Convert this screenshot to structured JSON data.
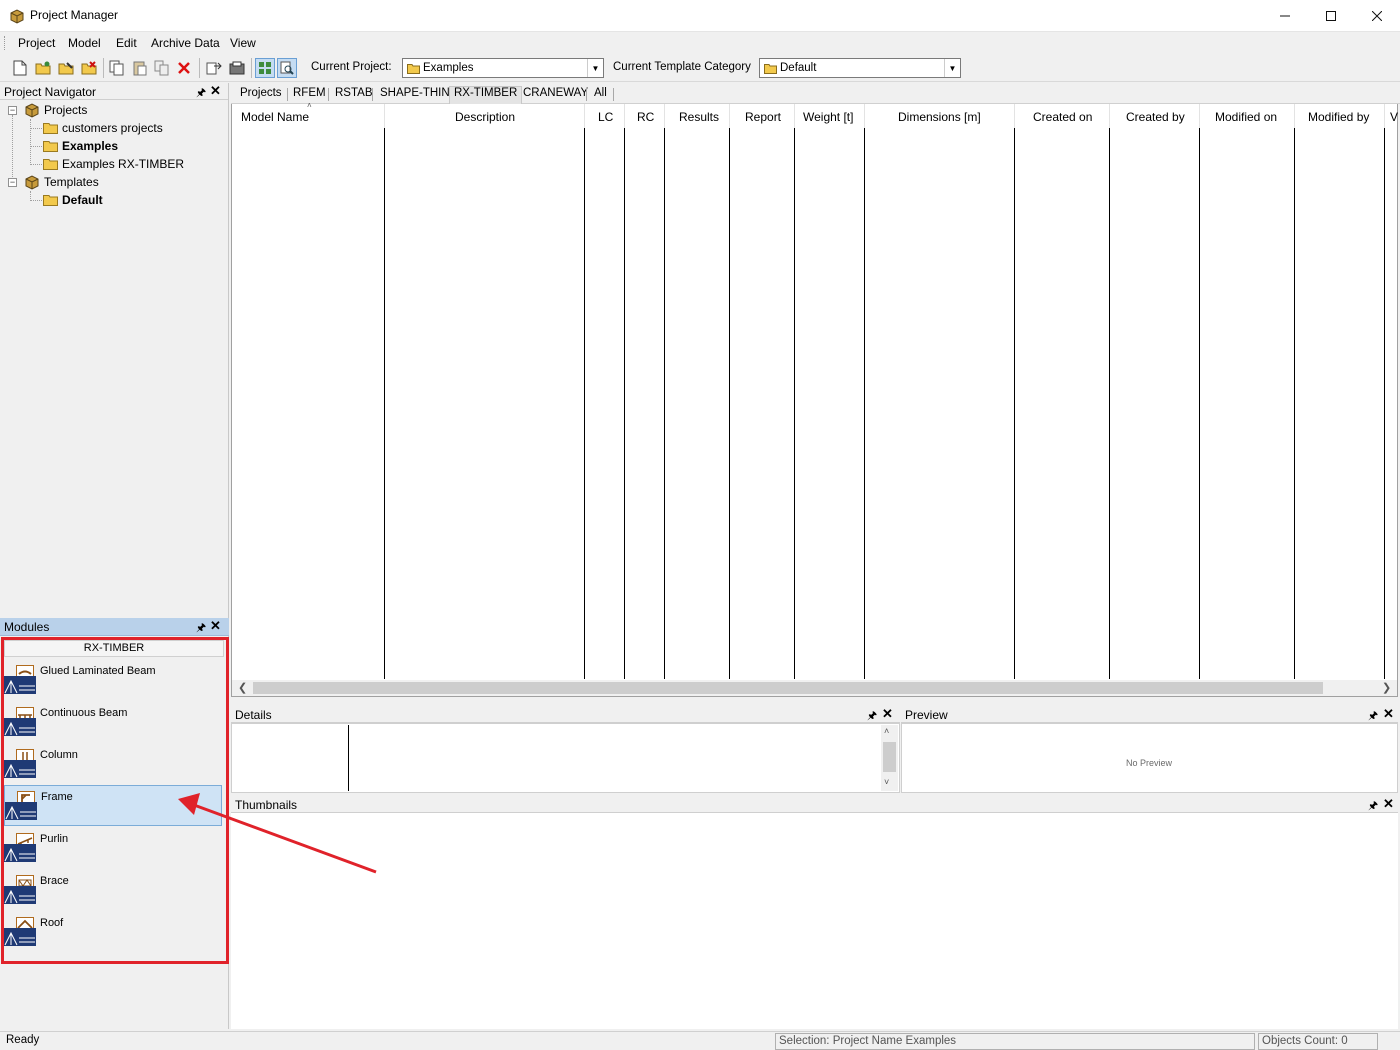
{
  "window": {
    "title": "Project Manager"
  },
  "menu": {
    "items": [
      "Project",
      "Model",
      "Edit",
      "Archive Data",
      "View"
    ]
  },
  "toolbar": {
    "current_project_label": "Current Project:",
    "current_project_value": "Examples",
    "template_category_label": "Current Template Category",
    "template_category_value": "Default"
  },
  "navigator": {
    "title": "Project Navigator",
    "tree": [
      {
        "label": "Projects",
        "bold": false
      },
      {
        "label": "customers projects",
        "bold": false
      },
      {
        "label": "Examples",
        "bold": true
      },
      {
        "label": "Examples RX-TIMBER",
        "bold": false
      },
      {
        "label": "Templates",
        "bold": false
      },
      {
        "label": "Default",
        "bold": true
      }
    ]
  },
  "modules": {
    "title": "Modules",
    "category": "RX-TIMBER",
    "items": [
      "Glued Laminated Beam",
      "Continuous Beam",
      "Column",
      "Frame",
      "Purlin",
      "Brace",
      "Roof"
    ],
    "selected": "Frame"
  },
  "tabs": [
    "Projects",
    "RFEM",
    "RSTAB",
    "SHAPE-THIN",
    "RX-TIMBER",
    "CRANEWAY",
    "All"
  ],
  "active_tab": "RX-TIMBER",
  "table": {
    "columns": [
      "Model Name",
      "Description",
      "LC",
      "RC",
      "Results",
      "Report",
      "Weight [t]",
      "Dimensions [m]",
      "Created on",
      "Created by",
      "Modified on",
      "Modified by",
      "V"
    ],
    "rows": []
  },
  "details": {
    "title": "Details"
  },
  "preview": {
    "title": "Preview",
    "empty_text": "No Preview"
  },
  "thumbnails": {
    "title": "Thumbnails"
  },
  "status": {
    "left": "Ready",
    "selection": "Selection: Project Name Examples",
    "objects_count": "Objects Count: 0"
  },
  "annotation": {
    "highlight_color": "#e0222a"
  }
}
